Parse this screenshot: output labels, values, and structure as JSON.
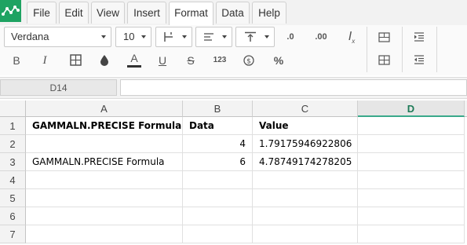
{
  "menu": {
    "items": [
      {
        "label": "File"
      },
      {
        "label": "Edit"
      },
      {
        "label": "View"
      },
      {
        "label": "Insert"
      },
      {
        "label": "Format"
      },
      {
        "label": "Data"
      },
      {
        "label": "Help"
      }
    ],
    "active": "Format"
  },
  "toolbar": {
    "font_family": "Verdana",
    "font_size": "10",
    "bold": "B",
    "italic": "I",
    "text_color": "A",
    "underline": "U",
    "strike": "S",
    "number_format": "123",
    "percent": "%",
    "decimals_less": ".0",
    "decimals_more": ".00"
  },
  "formula_bar": {
    "cell_ref": "D14",
    "value": ""
  },
  "sheet": {
    "columns": [
      "A",
      "B",
      "C",
      "D"
    ],
    "selected_column": "D",
    "rows": [
      "1",
      "2",
      "3",
      "4",
      "5",
      "6",
      "7"
    ],
    "cells": {
      "A1": "GAMMALN.PRECISE Formula",
      "B1": "Data",
      "C1": "Value",
      "A2": "",
      "B2": "4",
      "C2": "1.79175946922806",
      "A3": "GAMMALN.PRECISE Formula",
      "B3": "6",
      "C3": "4.78749174278205"
    }
  },
  "colors": {
    "accent": "#1ea362",
    "selected_header": "#3aa98a"
  }
}
